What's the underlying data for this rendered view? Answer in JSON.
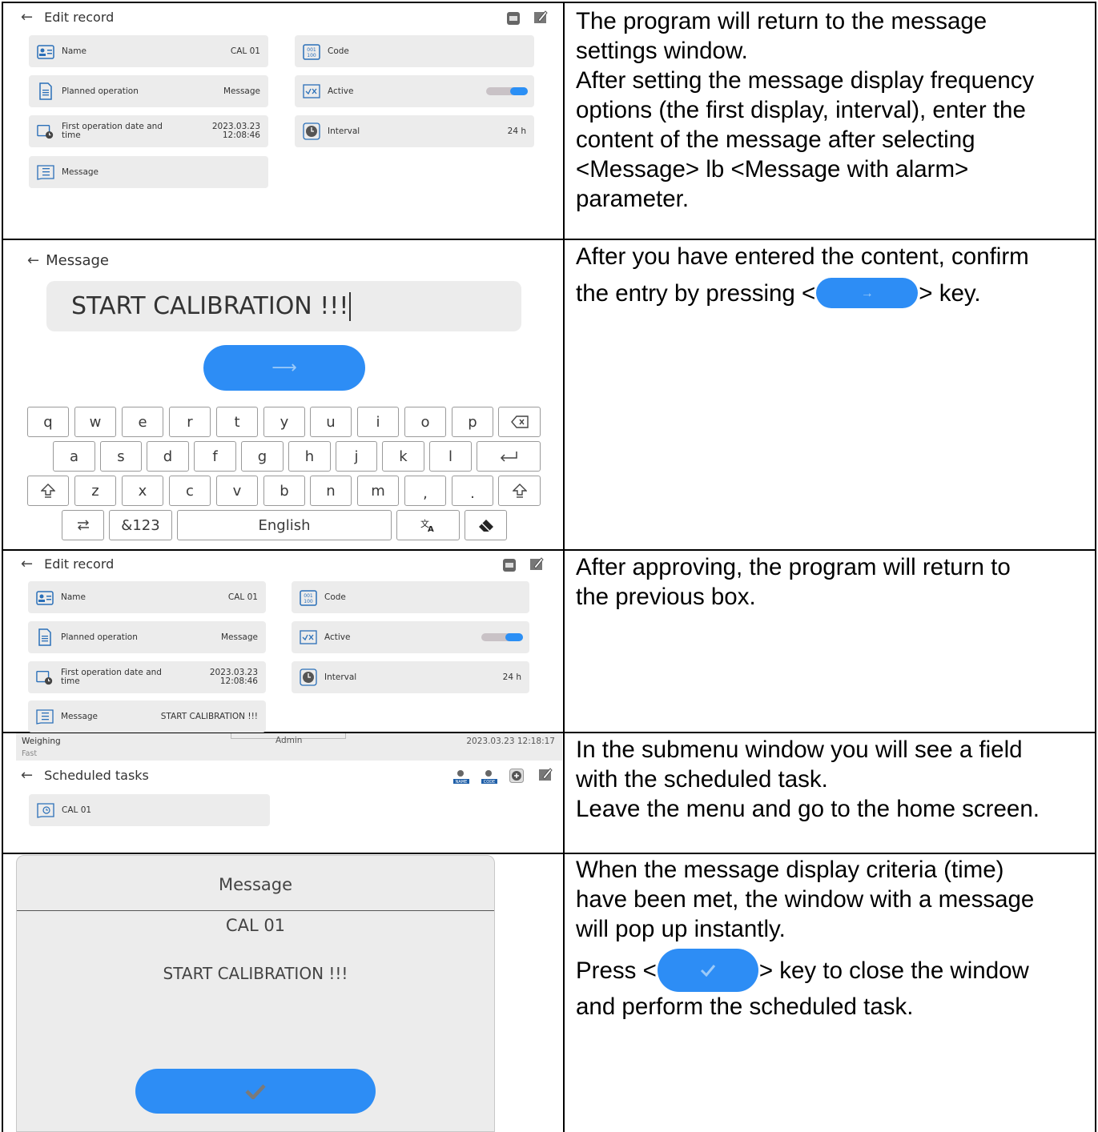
{
  "rows": [
    {
      "screen": {
        "header": {
          "back_icon": "arrow-left-icon",
          "title": "Edit record"
        },
        "toolbar": [
          {
            "icon": "print-icon"
          },
          {
            "icon": "edit-icon"
          }
        ],
        "fields": [
          {
            "icon": "name-card-icon",
            "label": "Name",
            "value": "CAL 01"
          },
          {
            "icon": "code-icon",
            "label": "Code",
            "value": ""
          },
          {
            "icon": "document-icon",
            "label": "Planned operation",
            "value": "Message"
          },
          {
            "icon": "checkbox-icon",
            "label": "Active",
            "toggle": true
          },
          {
            "icon": "calendar-clock-icon",
            "label_line1": "First operation date and",
            "label_line2": "time",
            "value_line1": "2023.03.23",
            "value_line2": "12:08:46"
          },
          {
            "icon": "clock-icon",
            "label": "Interval",
            "value": "24 h"
          },
          {
            "icon": "message-icon",
            "label": "Message",
            "value": ""
          }
        ]
      },
      "description": [
        "The program will return to the message",
        "settings window.",
        "After setting the message display frequency",
        "options (the first display, interval), enter the",
        "content of the message after selecting",
        "<Message> lb <Message with alarm>",
        "parameter."
      ]
    },
    {
      "screen": {
        "header": {
          "back_icon": "arrow-left-icon",
          "title": "Message"
        },
        "input_value": "START CALIBRATION !!!",
        "confirm_icon": "arrow-right-icon",
        "keyboard": {
          "row1": [
            "q",
            "w",
            "e",
            "r",
            "t",
            "y",
            "u",
            "i",
            "o",
            "p"
          ],
          "backspace_icon": "backspace-icon",
          "row2": [
            "a",
            "s",
            "d",
            "f",
            "g",
            "h",
            "j",
            "k",
            "l"
          ],
          "enter_icon": "enter-icon",
          "shift_icon": "shift-icon",
          "row3": [
            "z",
            "x",
            "c",
            "v",
            "b",
            "n",
            "m",
            ",",
            "."
          ],
          "switch_icon": "keyboard-switch-icon",
          "symbols_label": "&123",
          "space_label": "English",
          "translate_icon": "translate-icon",
          "eraser_icon": "eraser-icon"
        }
      },
      "description_a": "After you have entered the content, confirm",
      "description_b1": "the entry by pressing <",
      "description_b2": "> key."
    },
    {
      "screen": {
        "header": {
          "back_icon": "arrow-left-icon",
          "title": "Edit record"
        },
        "fields": [
          {
            "label": "Name",
            "value": "CAL 01"
          },
          {
            "label": "Code",
            "value": ""
          },
          {
            "label": "Planned operation",
            "value": "Message"
          },
          {
            "label": "Active",
            "toggle": true
          },
          {
            "label_line1": "First operation date and",
            "label_line2": "time",
            "value_line1": "2023.03.23",
            "value_line2": "12:08:46"
          },
          {
            "label": "Interval",
            "value": "24 h"
          },
          {
            "label": "Message",
            "value": "START CALIBRATION !!!"
          }
        ]
      },
      "description": [
        "After approving, the program will return to",
        "the previous box."
      ]
    },
    {
      "screen": {
        "status_mode": "Weighing",
        "status_sub": "Fast",
        "status_user": "Admin",
        "status_datetime": "2023.03.23 12:18:17",
        "header": {
          "back_icon": "arrow-left-icon",
          "title": "Scheduled tasks"
        },
        "toolbar": [
          {
            "icon": "search-name-icon"
          },
          {
            "icon": "search-code-icon"
          },
          {
            "icon": "add-icon"
          },
          {
            "icon": "edit-icon"
          }
        ],
        "task_label": "CAL 01"
      },
      "description": [
        "In the submenu window you will see a field",
        "with the scheduled task.",
        "Leave the menu and go to the home screen."
      ]
    },
    {
      "screen": {
        "dialog_title": "Message",
        "record_name": "CAL 01",
        "message_text": "START CALIBRATION !!!",
        "confirm_icon": "checkmark-icon"
      },
      "description": [
        "When the message display criteria (time)",
        "have been met, the window with a message",
        "will pop up instantly."
      ],
      "description_press": "Press <",
      "description_press_rest": "> key to close the window",
      "description_last": "and perform the scheduled task."
    }
  ],
  "colors": {
    "accent": "#2d8df5",
    "tile": "#ececec",
    "border": "#000000"
  }
}
